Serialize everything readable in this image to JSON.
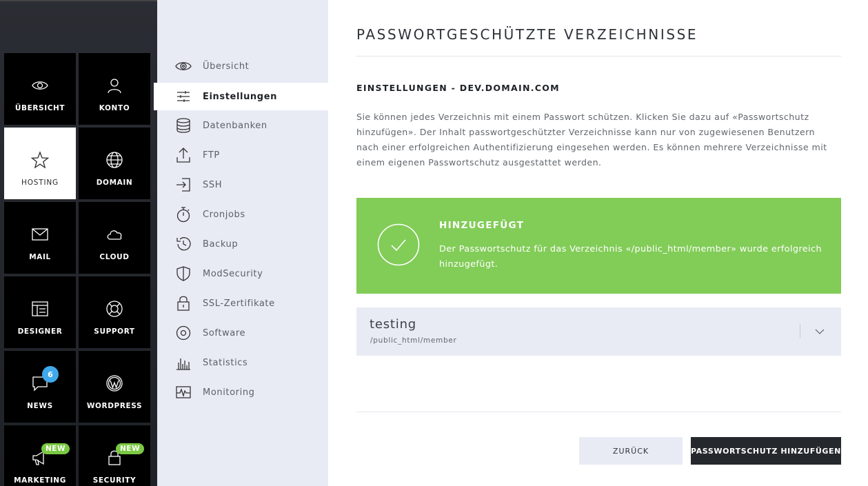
{
  "tiles": [
    {
      "id": "uebersicht",
      "label": "ÜBERSICHT",
      "icon": "eye-icon",
      "active": false
    },
    {
      "id": "konto",
      "label": "KONTO",
      "icon": "user-icon",
      "active": false
    },
    {
      "id": "hosting",
      "label": "HOSTING",
      "icon": "star-icon",
      "active": true
    },
    {
      "id": "domain",
      "label": "DOMAIN",
      "icon": "globe-icon",
      "active": false
    },
    {
      "id": "mail",
      "label": "MAIL",
      "icon": "envelope-icon",
      "active": false
    },
    {
      "id": "cloud",
      "label": "CLOUD",
      "icon": "cloud-icon",
      "active": false
    },
    {
      "id": "designer",
      "label": "DESIGNER",
      "icon": "layout-icon",
      "active": false
    },
    {
      "id": "support",
      "label": "SUPPORT",
      "icon": "lifebuoy-icon",
      "active": false
    },
    {
      "id": "news",
      "label": "NEWS",
      "icon": "chat-bubble-icon",
      "active": false,
      "badge": "6"
    },
    {
      "id": "wordpress",
      "label": "WORDPRESS",
      "icon": "wordpress-icon",
      "active": false
    },
    {
      "id": "marketing",
      "label": "MARKETING",
      "icon": "megaphone-icon",
      "active": false,
      "new_badge": "NEW"
    },
    {
      "id": "security",
      "label": "SECURITY",
      "icon": "lock-icon",
      "active": false,
      "new_badge": "NEW"
    }
  ],
  "subnav": [
    {
      "label": "Übersicht",
      "icon": "eye-icon",
      "active": false
    },
    {
      "label": "Einstellungen",
      "icon": "sliders-icon",
      "active": true
    },
    {
      "label": "Datenbanken",
      "icon": "database-icon",
      "active": false
    },
    {
      "label": "FTP",
      "icon": "upload-icon",
      "active": false
    },
    {
      "label": "SSH",
      "icon": "login-icon",
      "active": false
    },
    {
      "label": "Cronjobs",
      "icon": "stopwatch-icon",
      "active": false
    },
    {
      "label": "Backup",
      "icon": "history-icon",
      "active": false
    },
    {
      "label": "ModSecurity",
      "icon": "shield-icon",
      "active": false
    },
    {
      "label": "SSL-Zertifikate",
      "icon": "padlock-icon",
      "active": false
    },
    {
      "label": "Software",
      "icon": "disc-icon",
      "active": false
    },
    {
      "label": "Statistics",
      "icon": "bar-chart-icon",
      "active": false
    },
    {
      "label": "Monitoring",
      "icon": "pulse-icon",
      "active": false
    }
  ],
  "main": {
    "title": "PASSWORTGESCHÜTZTE VERZEICHNISSE",
    "section_title": "EINSTELLUNGEN - DEV.DOMAIN.COM",
    "description": "Sie können jedes Verzeichnis mit einem Passwort schützen. Klicken Sie dazu auf «Passwortschutz hinzufügen». Der Inhalt passwortgeschützter Verzeichnisse kann nur von zugewiesenen Benutzern nach einer erfolgreichen Authentifizierung eingesehen werden. Es können mehrere Verzeichnisse mit einem eigenen Passwortschutz ausgestattet werden.",
    "alert": {
      "title": "HINZUGEFÜGT",
      "text": "Der Passwortschutz für das Verzeichnis «/public_html/member» wurde erfolg­reich hinzugefügt.",
      "color": "#82cc58"
    },
    "directory": {
      "name": "testing",
      "path": "/public_html/member"
    },
    "buttons": {
      "back": "ZURÜCK",
      "add": "PASSWORTSCHUTZ HINZUFÜGEN"
    }
  },
  "colors": {
    "sidebar": "#000000",
    "subnav_bg": "#e8ebf4",
    "success": "#82cc58",
    "badge_blue": "#40a9ec",
    "badge_green": "#7ac943",
    "primary_button": "#25282d"
  }
}
